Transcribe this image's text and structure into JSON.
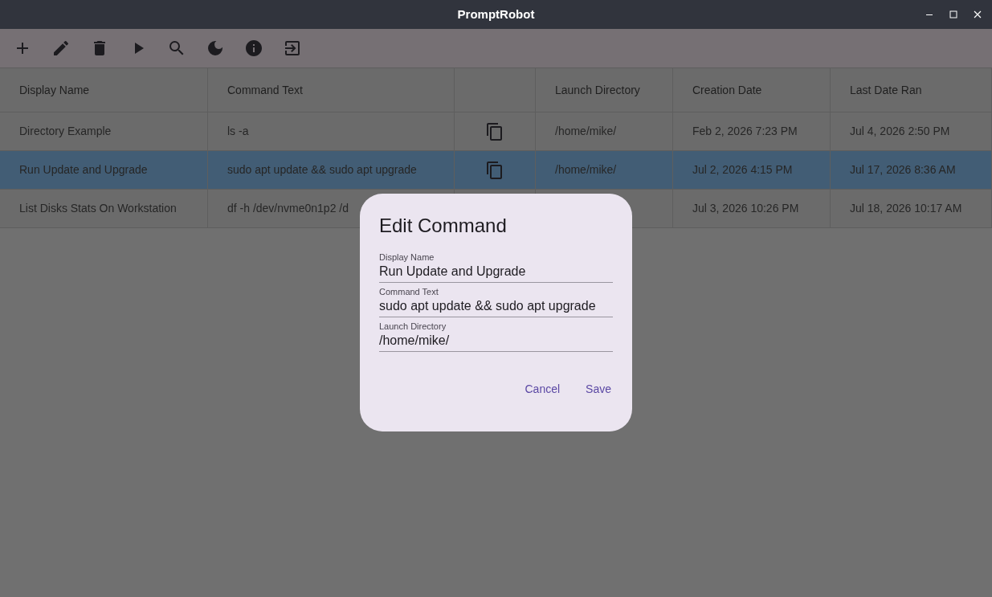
{
  "window": {
    "title": "PromptRobot"
  },
  "toolbar": [
    {
      "kind": "add"
    },
    {
      "kind": "edit"
    },
    {
      "kind": "delete"
    },
    {
      "kind": "run"
    },
    {
      "kind": "search"
    },
    {
      "kind": "theme"
    },
    {
      "kind": "info"
    },
    {
      "kind": "exit"
    }
  ],
  "table": {
    "columns": [
      "Display Name",
      "Command Text",
      null,
      "Launch Directory",
      "Creation Date",
      "Last Date Ran"
    ],
    "rows": [
      {
        "selected": false,
        "cells": [
          {
            "kind": "text",
            "text": "Directory Example"
          },
          {
            "kind": "text",
            "text": "ls -a"
          },
          {
            "kind": "copy"
          },
          {
            "kind": "text",
            "text": "/home/mike/"
          },
          {
            "kind": "text",
            "text": "Feb 2, 2026 7:23 PM"
          },
          {
            "kind": "text",
            "text": "Jul 4, 2026 2:50 PM"
          }
        ]
      },
      {
        "selected": true,
        "cells": [
          {
            "kind": "text",
            "text": "Run Update and Upgrade"
          },
          {
            "kind": "text",
            "text": "sudo apt update && sudo apt upgrade"
          },
          {
            "kind": "copy"
          },
          {
            "kind": "text",
            "text": "/home/mike/"
          },
          {
            "kind": "text",
            "text": "Jul 2, 2026 4:15 PM"
          },
          {
            "kind": "text",
            "text": "Jul 17, 2026 8:36 AM"
          }
        ]
      },
      {
        "selected": false,
        "cells": [
          {
            "kind": "text",
            "text": "List Disks Stats On Workstation"
          },
          {
            "kind": "text",
            "text": "df -h /dev/nvme0n1p2 /d"
          },
          null,
          null,
          {
            "kind": "text",
            "text": "Jul 3, 2026 10:26 PM"
          },
          {
            "kind": "text",
            "text": "Jul 18, 2026 10:17 AM"
          }
        ]
      }
    ]
  },
  "dialog": {
    "title": "Edit Command",
    "fields": [
      {
        "label": "Display Name",
        "value": "Run Update and Upgrade"
      },
      {
        "label": "Command Text",
        "value": "sudo apt update && sudo apt upgrade"
      },
      {
        "label": "Launch Directory",
        "value": "/home/mike/"
      }
    ],
    "buttons": [
      "Cancel",
      "Save"
    ]
  }
}
